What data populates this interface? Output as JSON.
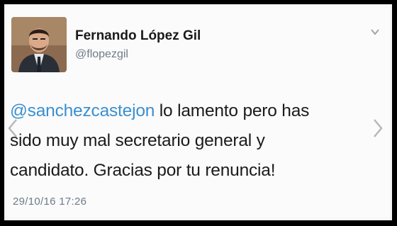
{
  "tweet": {
    "author": {
      "display_name": "Fernando López Gil",
      "handle": "@flopezgil",
      "avatar_icon": "profile-photo"
    },
    "text": {
      "mention": "@sanchezcastejon",
      "line1_rest": " lo lamento pero has",
      "line2": "sido muy mal secretario general y",
      "line3": "candidato. Gracias por tu renuncia!"
    },
    "timestamp": "29/10/16 17:26",
    "icons": {
      "menu": "chevron-down-icon",
      "prev": "chevron-left-icon",
      "next": "chevron-right-icon"
    },
    "colors": {
      "mention": "#3b8fd0",
      "secondary_text": "#6d7b88",
      "background": "#fbfbfb"
    }
  }
}
